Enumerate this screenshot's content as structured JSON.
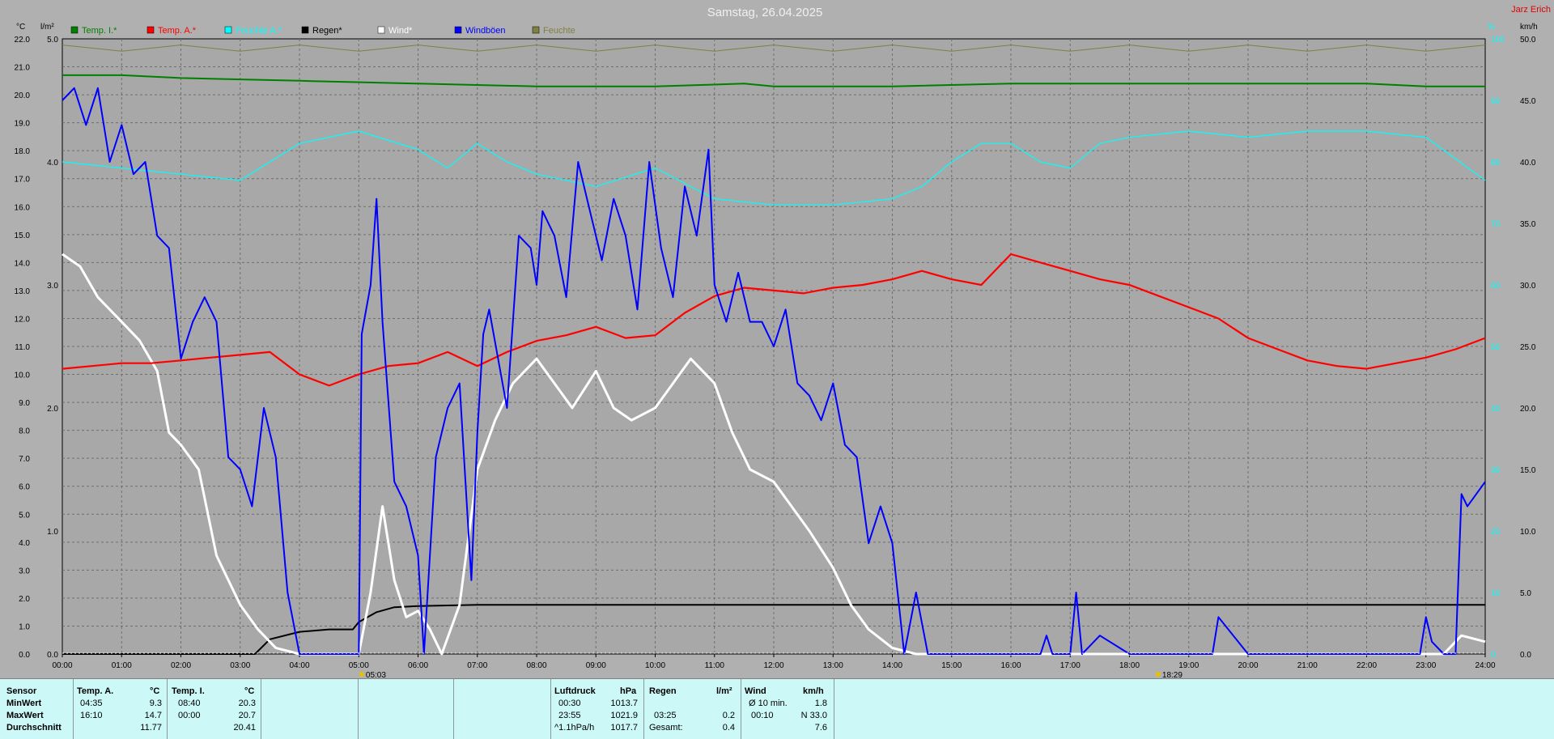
{
  "title": "Samstag, 26.04.2025",
  "author": "Jarz Erich",
  "units": {
    "left1": "°C",
    "left2": "l/m²",
    "right_top": "%",
    "right": "km/h"
  },
  "legend": [
    {
      "label": "Temp. I.*",
      "color": "#008000"
    },
    {
      "label": "Temp. A.*",
      "color": "#ff0000"
    },
    {
      "label": "Feuchte A.*",
      "color": "#00ffff"
    },
    {
      "label": "Regen*",
      "color": "#000000"
    },
    {
      "label": "Wind*",
      "color": "#ffffff"
    },
    {
      "label": "Windböen",
      "color": "#0000ff"
    },
    {
      "label": "Feuchte",
      "color": "#808040"
    }
  ],
  "markers": [
    {
      "label": "05:03",
      "symbol": "sunrise"
    },
    {
      "label": "18:29",
      "symbol": "sunset"
    }
  ],
  "chart_data": {
    "type": "line",
    "x_ticks": [
      "00:00",
      "01:00",
      "02:00",
      "03:00",
      "04:00",
      "05:00",
      "06:00",
      "07:00",
      "08:00",
      "09:00",
      "10:00",
      "11:00",
      "12:00",
      "13:00",
      "14:00",
      "15:00",
      "16:00",
      "17:00",
      "18:00",
      "19:00",
      "20:00",
      "21:00",
      "22:00",
      "23:00",
      "24:00"
    ],
    "axes": {
      "temp": {
        "label": "°C",
        "ylim": [
          0,
          22
        ],
        "ticks": [
          "0.0",
          "1.0",
          "2.0",
          "3.0",
          "4.0",
          "5.0",
          "6.0",
          "7.0",
          "8.0",
          "9.0",
          "10.0",
          "11.0",
          "12.0",
          "13.0",
          "14.0",
          "15.0",
          "16.0",
          "17.0",
          "18.0",
          "19.0",
          "20.0",
          "21.0",
          "22.0"
        ]
      },
      "rain": {
        "label": "l/m²",
        "ylim": [
          0,
          5
        ],
        "ticks": [
          "0.0",
          "1.0",
          "2.0",
          "3.0",
          "4.0",
          "5.0"
        ]
      },
      "humidity": {
        "label": "%",
        "ylim": [
          0,
          100
        ],
        "ticks": [
          "0",
          "10",
          "20",
          "30",
          "40",
          "50",
          "60",
          "70",
          "80",
          "90",
          "100"
        ]
      },
      "wind": {
        "label": "km/h",
        "ylim": [
          0,
          50
        ],
        "ticks": [
          "0.0",
          "5.0",
          "10.0",
          "15.0",
          "20.0",
          "25.0",
          "30.0",
          "35.0",
          "40.0",
          "45.0",
          "50.0"
        ]
      }
    },
    "grid": true,
    "series": [
      {
        "name": "Temp. I.*",
        "axis": "temp",
        "color": "#008000",
        "x": [
          0,
          1,
          2,
          4,
          6,
          8,
          10,
          11.5,
          12,
          14,
          16,
          18,
          20,
          22,
          23,
          24
        ],
        "y": [
          20.7,
          20.7,
          20.6,
          20.5,
          20.4,
          20.3,
          20.3,
          20.4,
          20.3,
          20.3,
          20.4,
          20.4,
          20.4,
          20.4,
          20.3,
          20.3
        ]
      },
      {
        "name": "Temp. A.*",
        "axis": "temp",
        "color": "#ff0000",
        "x": [
          0,
          0.5,
          1,
          1.5,
          2,
          2.5,
          3,
          3.5,
          4,
          4.5,
          5,
          5.5,
          6,
          6.5,
          7,
          7.5,
          8,
          8.5,
          9,
          9.5,
          10,
          10.5,
          11,
          11.5,
          12,
          12.5,
          13,
          13.5,
          14,
          14.5,
          15,
          15.5,
          16,
          16.5,
          17,
          17.5,
          18,
          18.5,
          19,
          19.5,
          20,
          20.5,
          21,
          21.5,
          22,
          22.5,
          23,
          23.5,
          24
        ],
        "y": [
          10.2,
          10.3,
          10.4,
          10.4,
          10.5,
          10.6,
          10.7,
          10.8,
          10.0,
          9.6,
          10.0,
          10.3,
          10.4,
          10.8,
          10.3,
          10.8,
          11.2,
          11.4,
          11.7,
          11.3,
          11.4,
          12.2,
          12.8,
          13.1,
          13.0,
          12.9,
          13.1,
          13.2,
          13.4,
          13.7,
          13.4,
          13.2,
          14.3,
          14.0,
          13.7,
          13.4,
          13.2,
          12.8,
          12.4,
          12.0,
          11.3,
          10.9,
          10.5,
          10.3,
          10.2,
          10.4,
          10.6,
          10.9,
          11.3
        ]
      },
      {
        "name": "Feuchte A.*",
        "axis": "humidity",
        "color": "#00ffff",
        "x": [
          0,
          1,
          2,
          3,
          4,
          5,
          6,
          6.5,
          7,
          7.5,
          8,
          9,
          10,
          11,
          12,
          13,
          14,
          14.5,
          15,
          15.5,
          16,
          16.5,
          17,
          17.5,
          18,
          19,
          20,
          21,
          22,
          23,
          24
        ],
        "y": [
          80,
          79,
          78,
          77,
          83,
          85,
          82,
          79,
          83,
          80,
          78,
          76,
          79,
          74,
          73,
          73,
          74,
          76,
          80,
          83,
          83,
          80,
          79,
          83,
          84,
          85,
          84,
          85,
          85,
          84,
          77
        ]
      },
      {
        "name": "Regen*",
        "axis": "rain",
        "color": "#000000",
        "x": [
          0,
          3.25,
          3.5,
          4,
          4.5,
          4.9,
          5.0,
          5.3,
          5.6,
          6,
          7,
          8,
          12,
          16,
          20,
          24
        ],
        "y": [
          0,
          0,
          0.12,
          0.18,
          0.2,
          0.2,
          0.26,
          0.34,
          0.38,
          0.39,
          0.4,
          0.4,
          0.4,
          0.4,
          0.4,
          0.4
        ]
      },
      {
        "name": "Wind*",
        "axis": "wind",
        "color": "#ffffff",
        "x": [
          0,
          0.3,
          0.6,
          1,
          1.3,
          1.6,
          1.8,
          2,
          2.3,
          2.6,
          3,
          3.3,
          3.6,
          4,
          4.5,
          5,
          5.2,
          5.4,
          5.6,
          5.8,
          6,
          6.2,
          6.4,
          6.7,
          7,
          7.3,
          7.6,
          8,
          8.3,
          8.6,
          9,
          9.3,
          9.6,
          10,
          10.3,
          10.6,
          11,
          11.3,
          11.6,
          12,
          12.3,
          12.6,
          13,
          13.3,
          13.6,
          14,
          14.4,
          14.8,
          15,
          16,
          18,
          20,
          22,
          22.3,
          22.6,
          23,
          23.3,
          23.6,
          24
        ],
        "y": [
          32.5,
          31.5,
          29,
          27,
          25.5,
          23,
          18,
          17,
          15,
          8,
          4,
          2,
          0.5,
          0,
          0,
          0,
          5,
          12,
          6,
          3,
          3.5,
          2,
          0,
          4,
          15,
          19,
          22,
          24,
          22,
          20,
          23,
          20,
          19,
          20,
          22,
          24,
          22,
          18,
          15,
          14,
          12,
          10,
          7,
          4,
          2,
          0.5,
          0,
          0,
          0,
          0,
          0,
          0,
          0,
          0,
          0,
          0,
          0,
          1.5,
          1
        ]
      },
      {
        "name": "Windböen",
        "axis": "wind",
        "color": "#0000ff",
        "x": [
          0,
          0.2,
          0.4,
          0.6,
          0.8,
          1,
          1.2,
          1.4,
          1.6,
          1.8,
          2,
          2.2,
          2.4,
          2.6,
          2.8,
          3,
          3.2,
          3.4,
          3.6,
          3.8,
          4,
          4.5,
          5,
          5.05,
          5.2,
          5.3,
          5.4,
          5.6,
          5.8,
          6,
          6.1,
          6.3,
          6.5,
          6.7,
          6.9,
          7,
          7.1,
          7.2,
          7.5,
          7.7,
          7.9,
          8,
          8.1,
          8.3,
          8.5,
          8.7,
          8.9,
          9.1,
          9.3,
          9.5,
          9.7,
          9.9,
          10.1,
          10.3,
          10.5,
          10.7,
          10.9,
          11,
          11.2,
          11.4,
          11.6,
          11.8,
          12,
          12.2,
          12.4,
          12.6,
          12.8,
          13,
          13.2,
          13.4,
          13.6,
          13.8,
          14,
          14.2,
          14.4,
          14.6,
          15,
          16,
          16.5,
          16.6,
          16.7,
          17,
          17.1,
          17.2,
          17.3,
          17.5,
          18,
          19,
          19.4,
          19.5,
          20,
          21,
          22,
          22.9,
          23,
          23.1,
          23.3,
          23.5,
          23.6,
          23.7,
          24
        ],
        "y": [
          45,
          46,
          43,
          46,
          40,
          43,
          39,
          40,
          34,
          33,
          24,
          27,
          29,
          27,
          16,
          15,
          12,
          20,
          16,
          5,
          0,
          0,
          0,
          26,
          30,
          37,
          27,
          14,
          12,
          8,
          0,
          16,
          20,
          22,
          6,
          18,
          26,
          28,
          20,
          34,
          33,
          30,
          36,
          34,
          29,
          40,
          36,
          32,
          37,
          34,
          28,
          40,
          33,
          29,
          38,
          34,
          41,
          30,
          27,
          31,
          27,
          27,
          25,
          28,
          22,
          21,
          19,
          22,
          17,
          16,
          9,
          12,
          9,
          0,
          5,
          0,
          0,
          0,
          0,
          1.5,
          0,
          0,
          5,
          0,
          0.5,
          1.5,
          0,
          0,
          0,
          3,
          0,
          0,
          0,
          0,
          3,
          1,
          0,
          0,
          13,
          12,
          14
        ]
      },
      {
        "name": "Feuchte",
        "axis": "humidity",
        "color": "#808040",
        "x": [
          0,
          1,
          2,
          3,
          4,
          5,
          6,
          7,
          8,
          9,
          10,
          11,
          12,
          13,
          14,
          15,
          16,
          17,
          18,
          19,
          20,
          21,
          22,
          23,
          24
        ],
        "y": [
          99,
          98,
          99,
          98,
          99,
          98,
          99,
          98,
          99,
          98,
          99,
          98,
          99,
          98,
          99,
          98,
          99,
          98,
          99,
          98,
          99,
          98,
          99,
          98,
          99
        ]
      }
    ]
  },
  "table": {
    "row_labels": [
      "Sensor",
      "MinWert",
      "MaxWert",
      "Durchschnitt"
    ],
    "temp_a": {
      "header": "Temp. A.",
      "unit": "°C",
      "rows": [
        [
          "04:35",
          "9.3"
        ],
        [
          "16:10",
          "14.7"
        ],
        [
          "",
          "11.77"
        ]
      ]
    },
    "temp_i": {
      "header": "Temp. I.",
      "unit": "°C",
      "rows": [
        [
          "08:40",
          "20.3"
        ],
        [
          "00:00",
          "20.7"
        ],
        [
          "",
          "20.41"
        ]
      ]
    },
    "pressure": {
      "header": "Luftdruck",
      "unit": "hPa",
      "rows": [
        [
          "00:30",
          "1013.7"
        ],
        [
          "23:55",
          "1021.9"
        ],
        [
          "^1.1hPa/h",
          "1017.7"
        ]
      ]
    },
    "rain": {
      "header": "Regen",
      "unit": "l/m²",
      "rows": [
        [
          "",
          ""
        ],
        [
          "03:25",
          "0.2"
        ],
        [
          "Gesamt:",
          "0.4"
        ]
      ]
    },
    "wind": {
      "header": "Wind",
      "unit": "km/h",
      "rows": [
        [
          "Ø 10 min.",
          "1.8"
        ],
        [
          "00:10",
          "N 33.0"
        ],
        [
          "",
          "7.6"
        ]
      ]
    }
  }
}
